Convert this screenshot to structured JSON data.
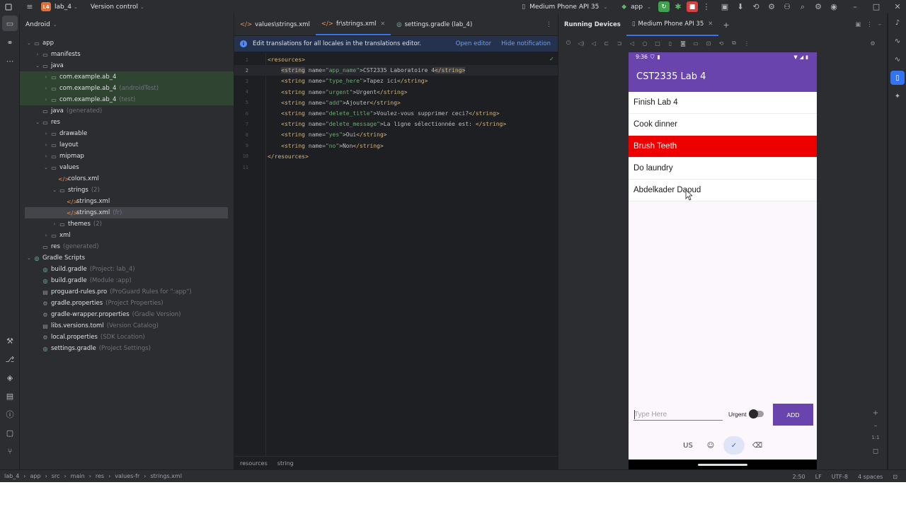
{
  "titlebar": {
    "project_badge": "L4",
    "project": "lab_4",
    "vcs": "Version control",
    "device": "Medium Phone API 35",
    "run_config": "app"
  },
  "project_panel": {
    "view": "Android",
    "tree": [
      {
        "label": "app",
        "hint": "",
        "depth": 0,
        "arrow": "v",
        "icon": "folder"
      },
      {
        "label": "manifests",
        "hint": "",
        "depth": 1,
        "arrow": ">",
        "icon": "folder"
      },
      {
        "label": "java",
        "hint": "",
        "depth": 1,
        "arrow": "v",
        "icon": "folder"
      },
      {
        "label": "com.example.ab_4",
        "hint": "",
        "depth": 2,
        "arrow": ">",
        "icon": "folder"
      },
      {
        "label": "com.example.ab_4",
        "hint": "(androidTest)",
        "depth": 2,
        "arrow": ">",
        "icon": "folder"
      },
      {
        "label": "com.example.ab_4",
        "hint": "(test)",
        "depth": 2,
        "arrow": ">",
        "icon": "folder"
      },
      {
        "label": "java",
        "hint": "(generated)",
        "depth": 1,
        "arrow": "",
        "icon": "folder"
      },
      {
        "label": "res",
        "hint": "",
        "depth": 1,
        "arrow": "v",
        "icon": "folder"
      },
      {
        "label": "drawable",
        "hint": "",
        "depth": 2,
        "arrow": ">",
        "icon": "folder"
      },
      {
        "label": "layout",
        "hint": "",
        "depth": 2,
        "arrow": ">",
        "icon": "folder"
      },
      {
        "label": "mipmap",
        "hint": "",
        "depth": 2,
        "arrow": ">",
        "icon": "folder"
      },
      {
        "label": "values",
        "hint": "",
        "depth": 2,
        "arrow": "v",
        "icon": "folder"
      },
      {
        "label": "colors.xml",
        "hint": "",
        "depth": 3,
        "arrow": "",
        "icon": "xml"
      },
      {
        "label": "strings",
        "hint": "(2)",
        "depth": 3,
        "arrow": "v",
        "icon": "folder"
      },
      {
        "label": "strings.xml",
        "hint": "",
        "depth": 4,
        "arrow": "",
        "icon": "xml"
      },
      {
        "label": "strings.xml",
        "hint": "(fr)",
        "depth": 4,
        "arrow": "",
        "icon": "xml"
      },
      {
        "label": "themes",
        "hint": "(2)",
        "depth": 3,
        "arrow": ">",
        "icon": "folder"
      },
      {
        "label": "xml",
        "hint": "",
        "depth": 2,
        "arrow": ">",
        "icon": "folder"
      },
      {
        "label": "res",
        "hint": "(generated)",
        "depth": 1,
        "arrow": "",
        "icon": "folder"
      },
      {
        "label": "Gradle Scripts",
        "hint": "",
        "depth": 0,
        "arrow": "v",
        "icon": "gradle"
      },
      {
        "label": "build.gradle",
        "hint": "(Project: lab_4)",
        "depth": 1,
        "arrow": "",
        "icon": "gradle"
      },
      {
        "label": "build.gradle",
        "hint": "(Module :app)",
        "depth": 1,
        "arrow": "",
        "icon": "gradle"
      },
      {
        "label": "proguard-rules.pro",
        "hint": "(ProGuard Rules for \":app\")",
        "depth": 1,
        "arrow": "",
        "icon": "file"
      },
      {
        "label": "gradle.properties",
        "hint": "(Project Properties)",
        "depth": 1,
        "arrow": "",
        "icon": "gear"
      },
      {
        "label": "gradle-wrapper.properties",
        "hint": "(Gradle Version)",
        "depth": 1,
        "arrow": "",
        "icon": "gear"
      },
      {
        "label": "libs.versions.toml",
        "hint": "(Version Catalog)",
        "depth": 1,
        "arrow": "",
        "icon": "file"
      },
      {
        "label": "local.properties",
        "hint": "(SDK Location)",
        "depth": 1,
        "arrow": "",
        "icon": "gear"
      },
      {
        "label": "settings.gradle",
        "hint": "(Project Settings)",
        "depth": 1,
        "arrow": "",
        "icon": "gradle"
      }
    ]
  },
  "editor": {
    "tabs": [
      {
        "label": "values\\strings.xml",
        "active": false
      },
      {
        "label": "fr\\strings.xml",
        "active": true
      },
      {
        "label": "settings.gradle (lab_4)",
        "active": false
      }
    ],
    "notification": {
      "text": "Edit translations for all locales in the translations editor.",
      "open_editor": "Open editor",
      "hide": "Hide notification"
    },
    "lines": [
      {
        "num": "1",
        "parts": [
          [
            "tg",
            "<resources>"
          ]
        ]
      },
      {
        "num": "2",
        "parts": [
          [
            "sp",
            "    "
          ],
          [
            "hl",
            "<string"
          ],
          [
            "at",
            " name="
          ],
          [
            "av",
            "\"app_name\""
          ],
          [
            "tx",
            ">CST2335 Laboratoire 4"
          ],
          [
            "hl",
            "</string>"
          ]
        ]
      },
      {
        "num": "3",
        "parts": [
          [
            "sp",
            "    "
          ],
          [
            "tg",
            "<string"
          ],
          [
            "at",
            " name="
          ],
          [
            "av",
            "\"type_here\""
          ],
          [
            "tx",
            ">Tapez ici"
          ],
          [
            "tg",
            "</string>"
          ]
        ]
      },
      {
        "num": "4",
        "parts": [
          [
            "sp",
            "    "
          ],
          [
            "tg",
            "<string"
          ],
          [
            "at",
            " name="
          ],
          [
            "av",
            "\"urgent\""
          ],
          [
            "tx",
            ">Urgent"
          ],
          [
            "tg",
            "</string>"
          ]
        ]
      },
      {
        "num": "5",
        "parts": [
          [
            "sp",
            "    "
          ],
          [
            "tg",
            "<string"
          ],
          [
            "at",
            " name="
          ],
          [
            "av",
            "\"add\""
          ],
          [
            "tx",
            ">Ajouter"
          ],
          [
            "tg",
            "</string>"
          ]
        ]
      },
      {
        "num": "6",
        "parts": [
          [
            "sp",
            "    "
          ],
          [
            "tg",
            "<string"
          ],
          [
            "at",
            " name="
          ],
          [
            "av",
            "\"delete_title\""
          ],
          [
            "tx",
            ">Voulez-vous supprimer ceci?"
          ],
          [
            "tg",
            "</string>"
          ]
        ]
      },
      {
        "num": "7",
        "parts": [
          [
            "sp",
            "    "
          ],
          [
            "tg",
            "<string"
          ],
          [
            "at",
            " name="
          ],
          [
            "av",
            "\"delete_message\""
          ],
          [
            "tx",
            ">La ligne sélectionnée est: "
          ],
          [
            "tg",
            "</string>"
          ]
        ]
      },
      {
        "num": "8",
        "parts": [
          [
            "sp",
            "    "
          ],
          [
            "tg",
            "<string"
          ],
          [
            "at",
            " name="
          ],
          [
            "av",
            "\"yes\""
          ],
          [
            "tx",
            ">Oui"
          ],
          [
            "tg",
            "</string>"
          ]
        ]
      },
      {
        "num": "9",
        "parts": [
          [
            "sp",
            "    "
          ],
          [
            "tg",
            "<string"
          ],
          [
            "at",
            " name="
          ],
          [
            "av",
            "\"no\""
          ],
          [
            "tx",
            ">Non"
          ],
          [
            "tg",
            "</string>"
          ]
        ]
      },
      {
        "num": "10",
        "parts": [
          [
            "tg",
            "</resources>"
          ]
        ]
      },
      {
        "num": "11",
        "parts": []
      }
    ],
    "current_line": "2",
    "breadcrumb": [
      "resources",
      "string"
    ]
  },
  "devices": {
    "title": "Running Devices",
    "tab": "Medium Phone API 35"
  },
  "phone": {
    "time": "9:36",
    "app_title": "CST2335 Lab 4",
    "items": [
      {
        "text": "Finish Lab 4",
        "urgent": false
      },
      {
        "text": "Cook dinner",
        "urgent": false
      },
      {
        "text": "Brush Teeth",
        "urgent": true
      },
      {
        "text": "Do laundry",
        "urgent": false
      },
      {
        "text": "Abdelkader Daoud",
        "urgent": false
      }
    ],
    "input_placeholder": "Type Here",
    "urgent_label": "Urgent",
    "add_label": "ADD",
    "keyboard_lang": "US",
    "colors": {
      "primary": "#6a44ad",
      "urgent": "#ef0000"
    }
  },
  "statusbar": {
    "path": [
      "lab_4",
      "app",
      "src",
      "main",
      "res",
      "values-fr",
      "strings.xml"
    ],
    "position": "2:50",
    "line_sep": "LF",
    "encoding": "UTF-8",
    "indent": "4 spaces"
  }
}
